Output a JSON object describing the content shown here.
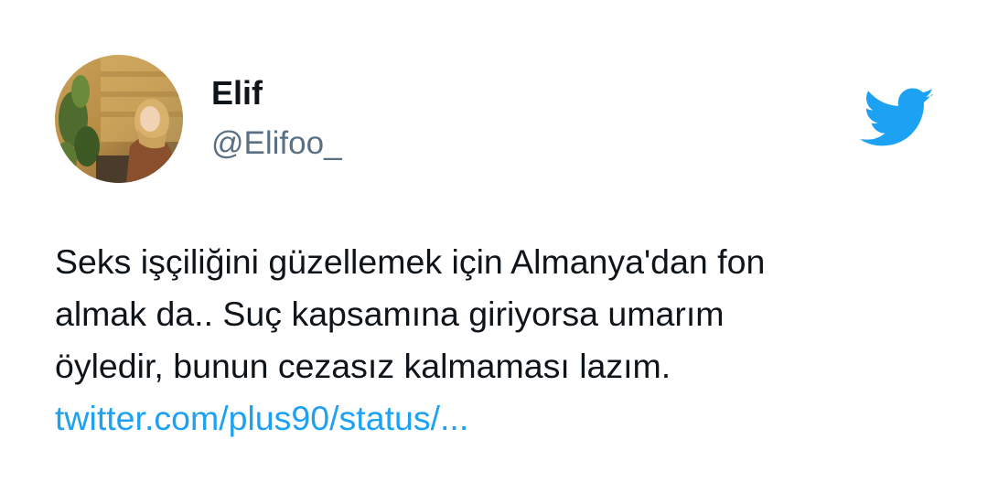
{
  "author": {
    "display_name": "Elif",
    "handle": "@Elifoo_",
    "avatar_icon": "profile-photo"
  },
  "brand": {
    "logo_icon": "twitter-bird-icon",
    "color": "#1da1f2"
  },
  "tweet": {
    "text": "Seks işçiliğini güzellemek için Almanya'dan fon\nalmak da.. Suç kapsamına giriyorsa umarım\nöyledir, bunun cezasız kalmaması lazım.",
    "link_text": "twitter.com/plus90/status/..."
  }
}
